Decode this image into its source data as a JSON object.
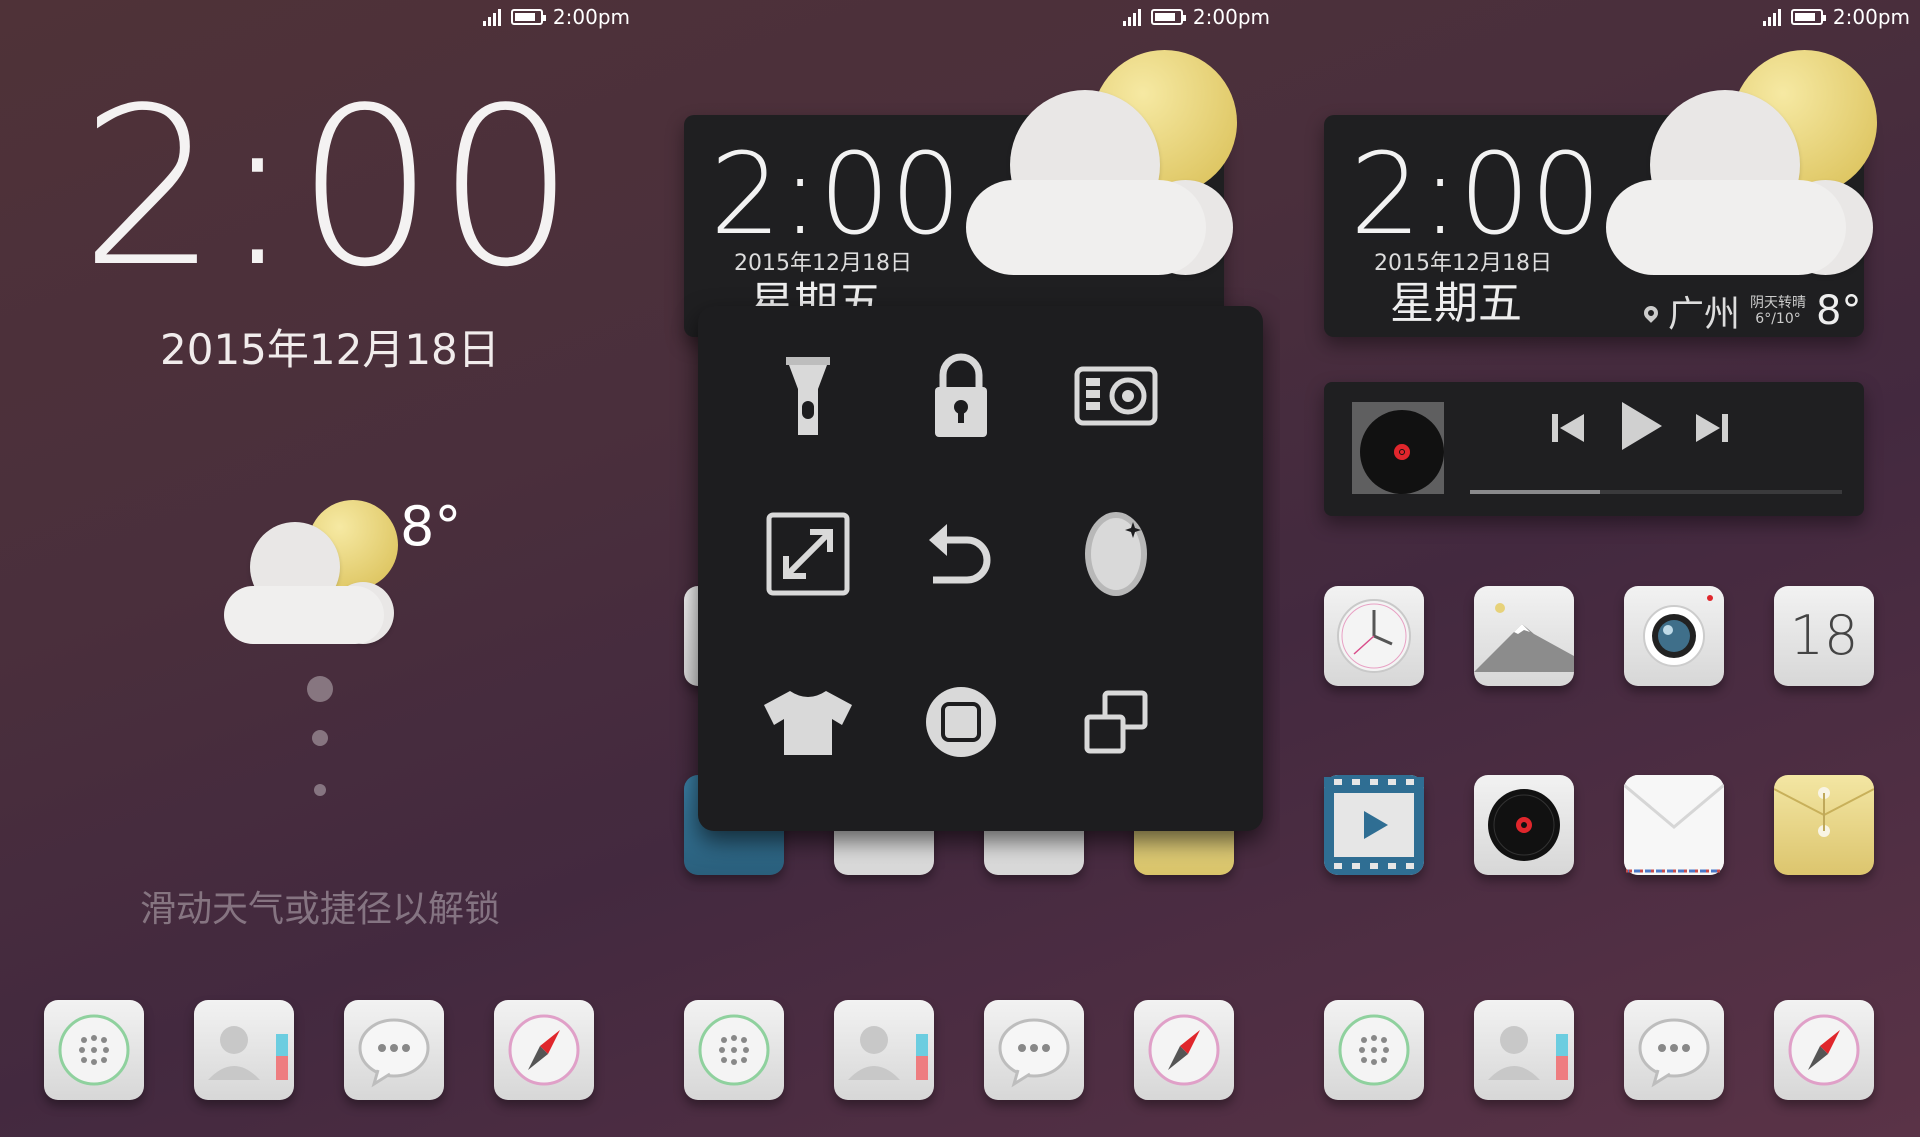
{
  "status_bar": {
    "time": "2:00pm"
  },
  "lock_screen": {
    "clock": "2:00",
    "date": "2015年12月18日",
    "temperature": "8°",
    "unlock_hint": "滑动天气或捷径以解锁"
  },
  "clock_widget": {
    "time": "2:00",
    "date": "2015年12月18日",
    "weekday": "星期五",
    "city": "广州",
    "condition": "阴天转晴",
    "range": "6°/10°",
    "temperature": "8°"
  },
  "music_widget": {
    "progress": 0.35
  },
  "calendar_icon": {
    "day": "18"
  },
  "shortcut_panel": {
    "items": [
      {
        "name": "flashlight-icon"
      },
      {
        "name": "lock-icon"
      },
      {
        "name": "radio-icon"
      },
      {
        "name": "fullscreen-icon"
      },
      {
        "name": "undo-icon"
      },
      {
        "name": "mirror-icon"
      },
      {
        "name": "theme-shirt-icon"
      },
      {
        "name": "home-button-icon"
      },
      {
        "name": "multitask-icon"
      }
    ]
  },
  "colors": {
    "accent_red": "#e0262c",
    "widget_bg": "#1f1f21",
    "sun_yellow": "#e6cf6a"
  }
}
